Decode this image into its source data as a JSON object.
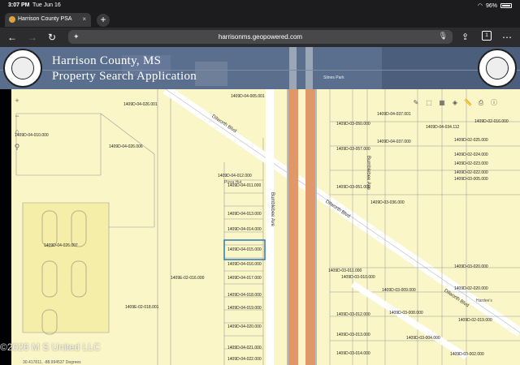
{
  "status_bar": {
    "time": "3:07 PM",
    "date": "Tue Jun 16",
    "battery_pct": "96%",
    "battery_level": 0.96
  },
  "browser": {
    "tab_title": "Harrison County PSA",
    "url": "harrisonms.geopowered.com",
    "tab_count": "1"
  },
  "banner": {
    "title_line1": "Harrison County, MS",
    "title_line2": "Property Search Application"
  },
  "map": {
    "place_labels": [
      "Hardee's",
      "Stines Park"
    ],
    "street_labels": [
      "Dilworth Blvd",
      "Dilworth Blvd",
      "Dilworth Blvd",
      "Bumblebee Ave",
      "Bumblebee Ave",
      "Pizza Hut"
    ],
    "parcel_labels": [
      "1409D-04-026.001",
      "1409D-04-005.001",
      "1409D-04-010.000",
      "1409D-04-026.006",
      "1409D-04-012.000",
      "1409D-04-011.000",
      "1409D-04-013.000",
      "1409D-04-014.000",
      "1409D-04-015.000",
      "1409D-04-016.000",
      "1409D-04-017.000",
      "1409D-04-018.000",
      "1409D-04-019.000",
      "1409D-04-020.000",
      "1409D-04-021.000",
      "1409D-04-022.000",
      "1409D-04-026.007",
      "1409E-02-016.000",
      "1409E-02-018.001",
      "1409D-04-037.001",
      "1409D-04-037.000",
      "1409D-03-051.000",
      "1409D-03-020.000",
      "1409D-03-005.000",
      "1409D-03-011.000",
      "1409D-03-010.000",
      "1409D-03-009.000",
      "1409D-03-012.000",
      "1409D-03-013.000",
      "1409D-03-014.000",
      "1409D-03-008.000",
      "1409D-03-004.000",
      "1409D-03-002.000",
      "1409D-02-016.000",
      "1409D-02-025.000",
      "1409D-02-024.000",
      "1409D-02-023.000",
      "1409D-02-022.000",
      "1409D-02-020.000",
      "1409D-02-019.000",
      "1409D-03-036.000",
      "1409D-03-050.000",
      "1409D-03-057.000",
      "1409D-04-034.112"
    ],
    "watermark": "©2026 M S United LLC",
    "coords": "30.417811, -88.994537 Degrees"
  },
  "colors": {
    "banner": "#5a6e8e",
    "map_bg": "#fbf6c7",
    "highway": "#e09868",
    "selected_parcel": "#2a7ab8"
  }
}
